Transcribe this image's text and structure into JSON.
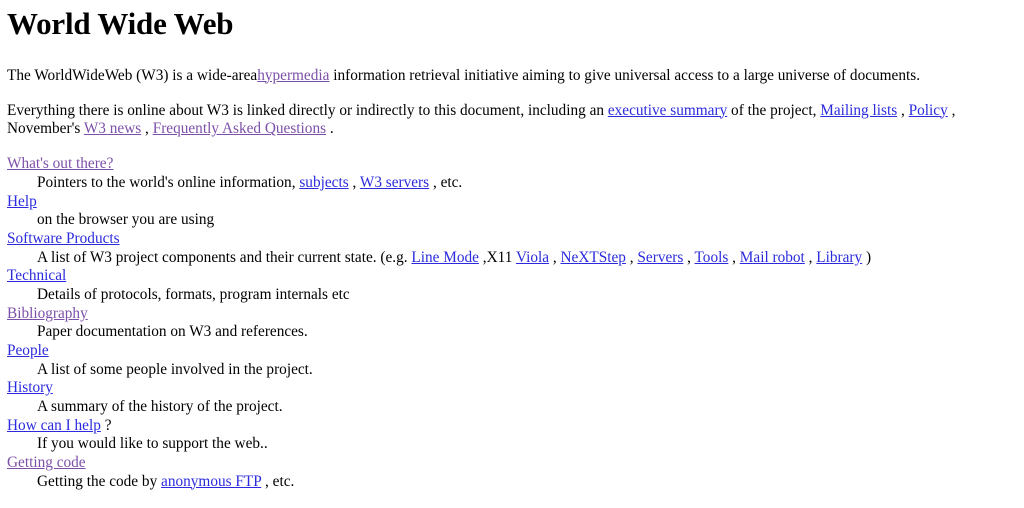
{
  "document": {
    "title": "World Wide Web",
    "colors": {
      "background": "#ffffff",
      "text": "#000000",
      "link_unvisited": "#2b2bdd",
      "link_visited": "#7c50a8"
    }
  },
  "intro": {
    "line1_part1": "The WorldWideWeb (W3) is a wide-area",
    "link_hypermedia": "hypermedia",
    "line1_part2": "information retrieval initiative aiming to give universal access to a large universe of documents.",
    "line2_part1": "Everything there is online about W3 is linked directly or indirectly to this document, including an",
    "link_executive_summary": "executive summary",
    "line2_part2": "of the project,",
    "link_mailing_lists": "Mailing lists",
    "comma1": ",",
    "link_policy": "Policy",
    "comma2": ",",
    "line3_part1": "November's",
    "link_w3_news": "W3 news",
    "comma3": ",",
    "link_faq": "Frequently Asked Questions",
    "period": "."
  },
  "entries": [
    {
      "term": "What's out there?",
      "term_state": "visited",
      "desc_parts": [
        {
          "type": "text",
          "value": "Pointers to the world's online information,"
        },
        {
          "type": "link",
          "value": "subjects",
          "state": "unvisited"
        },
        {
          "type": "text",
          "value": ","
        },
        {
          "type": "link",
          "value": "W3 servers",
          "state": "unvisited"
        },
        {
          "type": "text",
          "value": ", etc."
        }
      ]
    },
    {
      "term": "Help",
      "term_state": "unvisited",
      "desc_parts": [
        {
          "type": "text",
          "value": "on the browser you are using"
        }
      ]
    },
    {
      "term": "Software Products",
      "term_state": "unvisited",
      "desc_parts": [
        {
          "type": "text",
          "value": "A list of W3 project components and their current state. (e.g."
        },
        {
          "type": "link",
          "value": "Line Mode",
          "state": "unvisited"
        },
        {
          "type": "text",
          "value": ",X11"
        },
        {
          "type": "link",
          "value": "Viola",
          "state": "unvisited"
        },
        {
          "type": "text",
          "value": ","
        },
        {
          "type": "link",
          "value": "NeXTStep",
          "state": "unvisited"
        },
        {
          "type": "text",
          "value": ","
        },
        {
          "type": "link",
          "value": "Servers",
          "state": "unvisited"
        },
        {
          "type": "text",
          "value": ","
        },
        {
          "type": "link",
          "value": "Tools",
          "state": "unvisited"
        },
        {
          "type": "text",
          "value": ","
        },
        {
          "type": "link",
          "value": "Mail robot",
          "state": "unvisited"
        },
        {
          "type": "text",
          "value": ","
        },
        {
          "type": "link",
          "value": "Library",
          "state": "unvisited"
        },
        {
          "type": "text",
          "value": ")"
        }
      ]
    },
    {
      "term": "Technical",
      "term_state": "unvisited",
      "desc_parts": [
        {
          "type": "text",
          "value": "Details of protocols, formats, program internals etc"
        }
      ]
    },
    {
      "term": "Bibliography",
      "term_state": "visited",
      "desc_parts": [
        {
          "type": "text",
          "value": "Paper documentation on W3 and references."
        }
      ]
    },
    {
      "term": "People",
      "term_state": "unvisited",
      "desc_parts": [
        {
          "type": "text",
          "value": "A list of some people involved in the project."
        }
      ]
    },
    {
      "term": "History",
      "term_state": "unvisited",
      "desc_parts": [
        {
          "type": "text",
          "value": "A summary of the history of the project."
        }
      ]
    },
    {
      "term": "How can I help",
      "term_state": "unvisited",
      "term_suffix": "?",
      "desc_parts": [
        {
          "type": "text",
          "value": "If you would like to support the web.."
        }
      ]
    },
    {
      "term": "Getting code",
      "term_state": "visited",
      "desc_parts": [
        {
          "type": "text",
          "value": "Getting the code by"
        },
        {
          "type": "link",
          "value": "anonymous FTP",
          "state": "unvisited"
        },
        {
          "type": "text",
          "value": ", etc."
        }
      ]
    }
  ]
}
